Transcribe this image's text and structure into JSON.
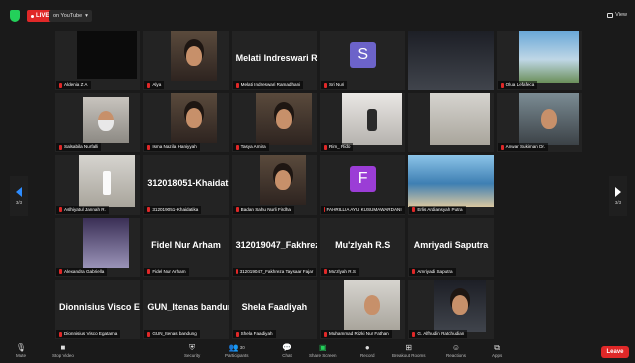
{
  "topbar": {
    "live_label": "LIVE",
    "live_target": "on YouTube",
    "view_label": "View"
  },
  "pager": {
    "left_indicator": "3/3",
    "right_indicator": "3/3"
  },
  "tiles": [
    {
      "name": "Aldenia Z A",
      "display": "video"
    },
    {
      "name": "Alya",
      "display": "video"
    },
    {
      "name": "Melati Indreswari Ramadhani",
      "display": "name",
      "big_name": "Melati Indreswari Ram..."
    },
    {
      "name": "Sri Nuri",
      "display": "avatar",
      "initial": "S",
      "avatar_color": "#6c63c9"
    },
    {
      "name": "",
      "display": "video"
    },
    {
      "name": "Olua Lefafeca",
      "display": "video"
    },
    {
      "name": "Salsabila Nurfalli",
      "display": "video"
    },
    {
      "name": "Isma Nazila Haniyyah",
      "display": "video"
    },
    {
      "name": "Tasya Amira",
      "display": "video"
    },
    {
      "name": "Rim_ Rido",
      "display": "video"
    },
    {
      "name": "",
      "display": "video"
    },
    {
      "name": "Anwar Sukiman Dr.",
      "display": "video"
    },
    {
      "name": "Aslhiyatul Jannah R.",
      "display": "video"
    },
    {
      "name": "312019051-Khaidatika",
      "display": "name",
      "big_name": "312018051-Khaidatika"
    },
    {
      "name": "Badan Sahu Nurli Firdha",
      "display": "video"
    },
    {
      "name": "FAHRILLIA AYU KUSUMAWARDANI",
      "display": "avatar",
      "initial": "F",
      "avatar_color": "#9b3dd6"
    },
    {
      "name": "Erlis Ardiansyah Putra",
      "display": "video"
    },
    {
      "name": "",
      "display": "none"
    },
    {
      "name": "Alexandra Gabriella",
      "display": "video"
    },
    {
      "name": "Fidel Nur Arham",
      "display": "name",
      "big_name": "Fidel Nur Arham"
    },
    {
      "name": "312019047_Fakhreza Taysaar Fajar",
      "display": "name",
      "big_name": "312019047_Fakhreza..."
    },
    {
      "name": "Mu'zlyah R.S",
      "display": "name",
      "big_name": "Mu'zlyah R.S"
    },
    {
      "name": "Amriyadi Saputra",
      "display": "name",
      "big_name": "Amriyadi Saputra"
    },
    {
      "name": "",
      "display": "none"
    },
    {
      "name": "Dionnisius Visco Egatama",
      "display": "name",
      "big_name": "Dionnisius Visco Egat..."
    },
    {
      "name": "GUN_Itenas bandung",
      "display": "name",
      "big_name": "GUN_Itenas bandung"
    },
    {
      "name": "Shela Faadiyah",
      "display": "name",
      "big_name": "Shela Faadiyah"
    },
    {
      "name": "Muhammad Rizki Nur Fathan",
      "display": "video"
    },
    {
      "name": "G. Alfhudin Ratchudian",
      "display": "video"
    },
    {
      "name": "",
      "display": "none"
    }
  ],
  "toolbar": {
    "mute": "Mute",
    "stop_video": "Stop Video",
    "security": "Security",
    "participants": "Participants",
    "participants_count": "30",
    "chat": "Chat",
    "share_screen": "Share Screen",
    "record": "Record",
    "breakout_rooms": "Breakout Rooms",
    "reactions": "Reactions",
    "apps": "Apps",
    "leave": "Leave"
  }
}
